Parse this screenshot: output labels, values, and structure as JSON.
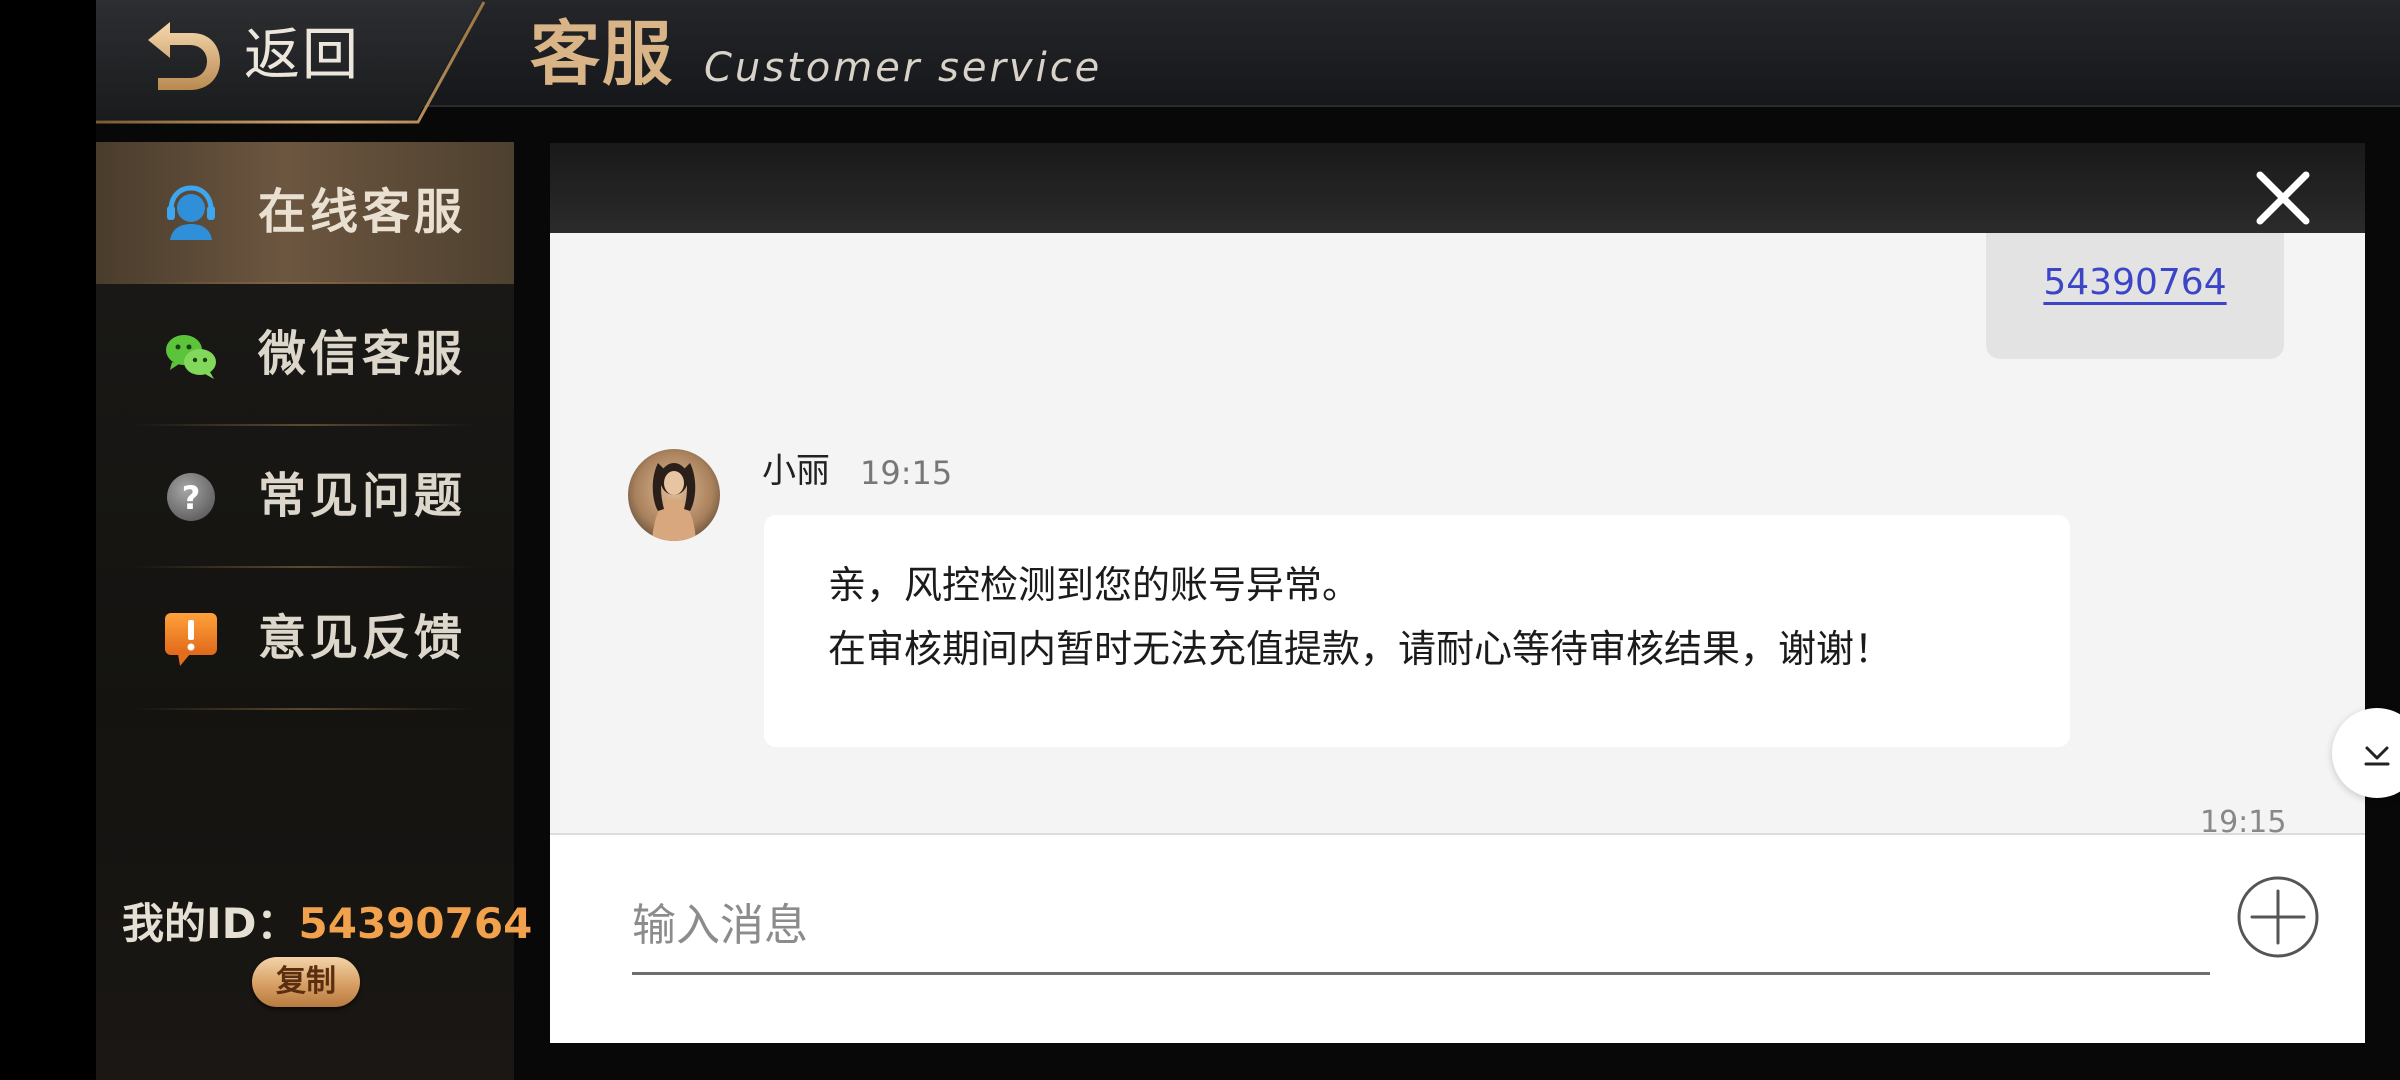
{
  "header": {
    "back_label": "返回",
    "title": "客服",
    "subtitle": "Customer service"
  },
  "sidebar": {
    "items": [
      {
        "label": "在线客服",
        "icon": "customer-service-headset-icon",
        "active": true
      },
      {
        "label": "微信客服",
        "icon": "wechat-icon",
        "active": false
      },
      {
        "label": "常见问题",
        "icon": "question-icon",
        "active": false
      },
      {
        "label": "意见反馈",
        "icon": "feedback-exclamation-icon",
        "active": false
      }
    ],
    "id_label": "我的ID：",
    "id_value": "54390764",
    "copy_label": "复制"
  },
  "chat": {
    "my_message": "54390764",
    "agent": {
      "name": "小丽",
      "time": "19:15",
      "lines": [
        "亲，风控检测到您的账号异常。",
        "在审核期间内暂时无法充值提款，请耐心等待审核结果，谢谢！"
      ]
    },
    "bottom_time": "19:15",
    "input_placeholder": "输入消息"
  },
  "colors": {
    "accent_gold": "#d9b487",
    "id_orange": "#f2a24c",
    "link_blue": "#3c45c8"
  }
}
